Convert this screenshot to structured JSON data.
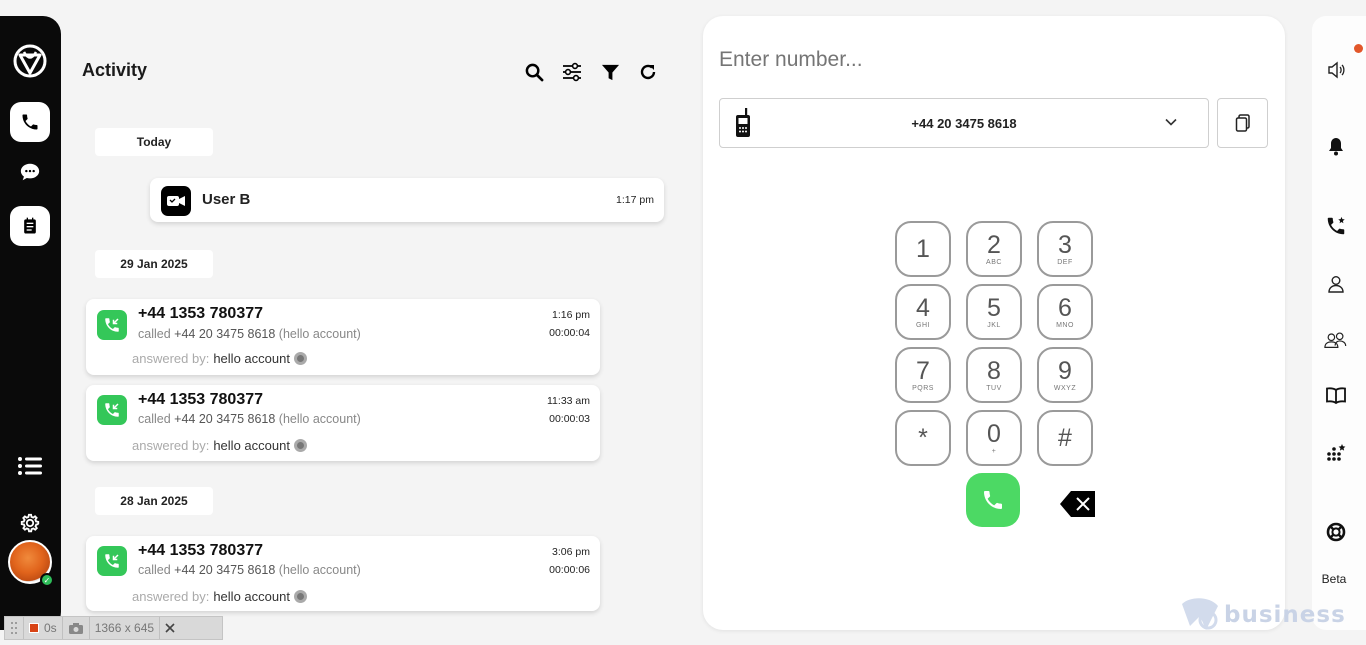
{
  "activity": {
    "title": "Activity",
    "toolbar": [
      "search-icon",
      "sliders-icon",
      "filter-icon",
      "refresh-icon"
    ]
  },
  "groups": [
    {
      "date": "Today",
      "items": [
        {
          "name": "User B",
          "time": "1:17 pm",
          "icon": "video-call-icon"
        }
      ]
    },
    {
      "date": "29 Jan 2025",
      "items": [
        {
          "number": "+44 1353 780377",
          "called_prefix": "called",
          "called_number": "+44 20 3475 8618",
          "called_account": "(hello account)",
          "answered_label": "answered by:",
          "answered_by": "hello account",
          "time": "1:16 pm",
          "duration": "00:00:04"
        },
        {
          "number": "+44 1353 780377",
          "called_prefix": "called",
          "called_number": "+44 20 3475 8618",
          "called_account": "(hello account)",
          "answered_label": "answered by:",
          "answered_by": "hello account",
          "time": "11:33 am",
          "duration": "00:00:03"
        }
      ]
    },
    {
      "date": "28 Jan 2025",
      "items": [
        {
          "number": "+44 1353 780377",
          "called_prefix": "called",
          "called_number": "+44 20 3475 8618",
          "called_account": "(hello account)",
          "answered_label": "answered by:",
          "answered_by": "hello account",
          "time": "3:06 pm",
          "duration": "00:00:06"
        }
      ]
    }
  ],
  "dialer": {
    "placeholder": "Enter number...",
    "caller_id": "+44 20 3475 8618",
    "keys": [
      {
        "d": "1",
        "l": ""
      },
      {
        "d": "2",
        "l": "ABC"
      },
      {
        "d": "3",
        "l": "DEF"
      },
      {
        "d": "4",
        "l": "GHI"
      },
      {
        "d": "5",
        "l": "JKL"
      },
      {
        "d": "6",
        "l": "MNO"
      },
      {
        "d": "7",
        "l": "PQRS"
      },
      {
        "d": "8",
        "l": "TUV"
      },
      {
        "d": "9",
        "l": "WXYZ"
      },
      {
        "d": "*",
        "l": ""
      },
      {
        "d": "0",
        "l": "+"
      },
      {
        "d": "#",
        "l": ""
      }
    ]
  },
  "rightbar": {
    "beta_label": "Beta",
    "icons": [
      "speaker-icon",
      "bell-icon",
      "transfer-call-icon",
      "contact-icon",
      "group-icon",
      "book-icon",
      "dialpad-star-icon",
      "help-lifebuoy-icon"
    ],
    "notification_color": "#e2572a"
  },
  "recorder": {
    "time": "0s",
    "size": "1366 x 645"
  },
  "watermark": "business",
  "colors": {
    "green": "#34c759",
    "call_green": "#4cd964",
    "sidebar": "#0a0a0a"
  }
}
